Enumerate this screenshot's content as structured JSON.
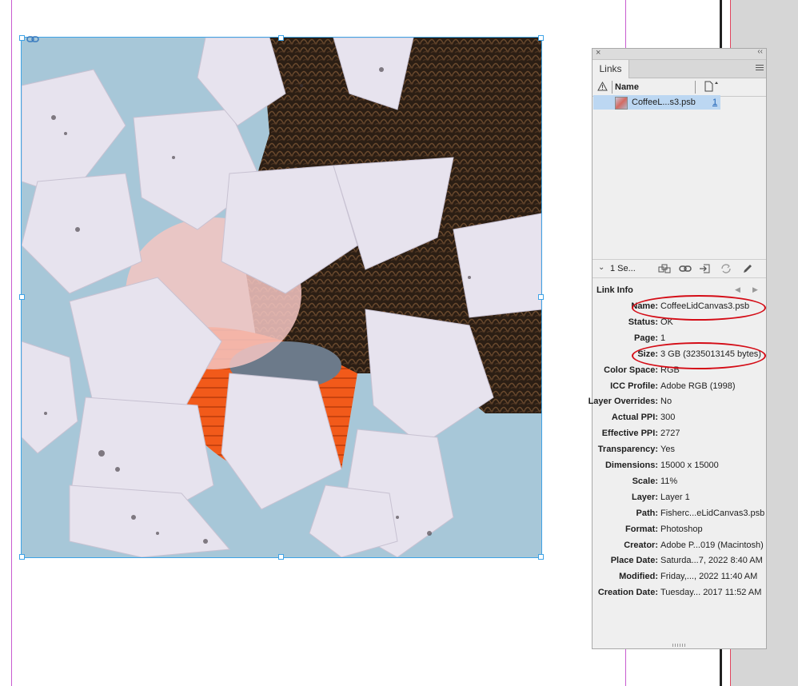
{
  "panel": {
    "close": "×",
    "collapse": "‹‹",
    "tab": "Links",
    "columns": {
      "name": "Name"
    },
    "links": [
      {
        "name": "CoffeeL...s3.psb",
        "page": "1"
      }
    ],
    "selection": "1 Se...",
    "link_info": {
      "title": "Link Info",
      "rows": [
        {
          "label": "Name:",
          "value": "CoffeeLidCanvas3.psb"
        },
        {
          "label": "Status:",
          "value": "OK"
        },
        {
          "label": "Page:",
          "value": "1"
        },
        {
          "label": "Size:",
          "value": "3 GB (3235013145 bytes)"
        },
        {
          "label": "Color Space:",
          "value": "RGB"
        },
        {
          "label": "ICC Profile:",
          "value": "Adobe RGB (1998)"
        },
        {
          "label": "Layer Overrides:",
          "value": "No"
        },
        {
          "label": "Actual PPI:",
          "value": "300"
        },
        {
          "label": "Effective PPI:",
          "value": "2727"
        },
        {
          "label": "Transparency:",
          "value": "Yes"
        },
        {
          "label": "Dimensions:",
          "value": "15000 x 15000"
        },
        {
          "label": "Scale:",
          "value": "11%"
        },
        {
          "label": "Layer:",
          "value": "Layer 1"
        },
        {
          "label": "Path:",
          "value": "Fisherc...eLidCanvas3.psb"
        },
        {
          "label": "Format:",
          "value": "Photoshop"
        },
        {
          "label": "Creator:",
          "value": "Adobe P...019 (Macintosh)"
        },
        {
          "label": "Place Date:",
          "value": "Saturda...7, 2022 8:40 AM"
        },
        {
          "label": "Modified:",
          "value": "Friday,..., 2022 11:40 AM"
        },
        {
          "label": "Creation Date:",
          "value": "Tuesday... 2017 11:52 AM"
        }
      ]
    }
  },
  "colors": {
    "selection_blue": "#3fa3e6",
    "annotation_red": "#d40c16",
    "canvas_background": "#a7c7d8"
  }
}
